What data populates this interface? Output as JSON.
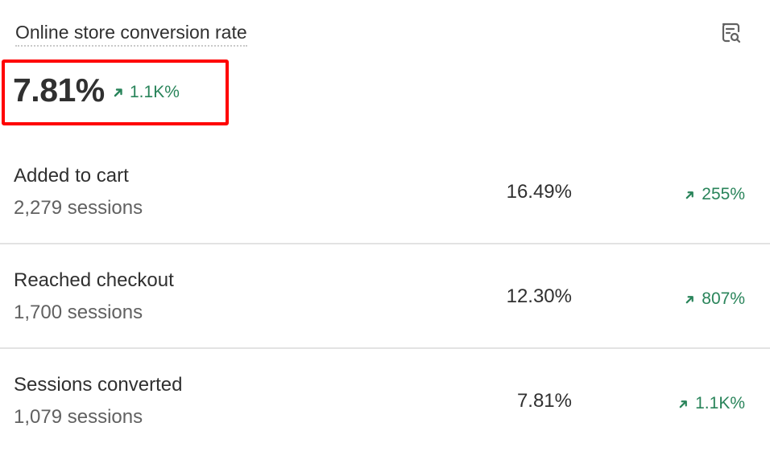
{
  "card": {
    "title": "Online store conversion rate",
    "icon": "report-search-icon",
    "value": "7.81%",
    "change": "1.1K%",
    "change_direction": "up",
    "accent_color": "#29845a",
    "highlight_color": "#ff0000"
  },
  "rows": [
    {
      "label": "Added to cart",
      "sessions": "2,279 sessions",
      "rate": "16.49%",
      "change": "255%"
    },
    {
      "label": "Reached checkout",
      "sessions": "1,700 sessions",
      "rate": "12.30%",
      "change": "807%"
    },
    {
      "label": "Sessions converted",
      "sessions": "1,079 sessions",
      "rate": "7.81%",
      "change": "1.1K%"
    }
  ]
}
